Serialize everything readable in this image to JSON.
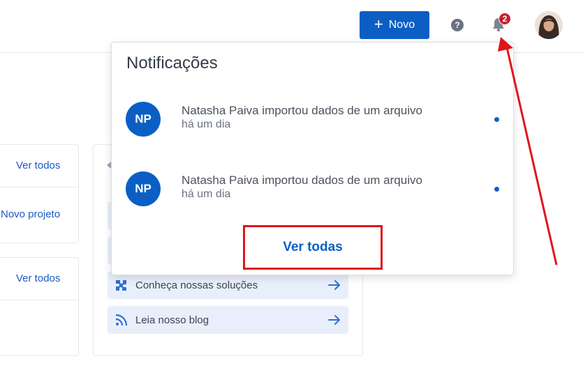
{
  "header": {
    "new_button": {
      "icon": "plus-icon",
      "label": "Novo"
    },
    "help_icon": "question-circle-icon",
    "help_glyph": "?",
    "bell_icon": "bell-icon",
    "notification_count": "2",
    "avatar_icon": "user-avatar"
  },
  "cards": {
    "card1_link": "Ver todos",
    "card1_action": "Novo projeto",
    "card2_link": "Ver todos",
    "links": [
      {
        "label": "Conheça nossas soluções",
        "icon": "puzzle-icon"
      },
      {
        "label": "Leia nosso blog",
        "icon": "rss-icon"
      }
    ]
  },
  "notifications": {
    "title": "Notificações",
    "items": [
      {
        "initials": "NP",
        "message": "Natasha Paiva importou dados de um arquivo",
        "time": "há um dia",
        "unread": true
      },
      {
        "initials": "NP",
        "message": "Natasha Paiva importou dados de um arquivo",
        "time": "há um dia",
        "unread": true
      }
    ],
    "see_all": "Ver todas"
  },
  "colors": {
    "primary": "#0b5fc4",
    "badge": "#c7212b",
    "annotation": "#e0151b",
    "link_row_bg": "#e9eefb"
  }
}
